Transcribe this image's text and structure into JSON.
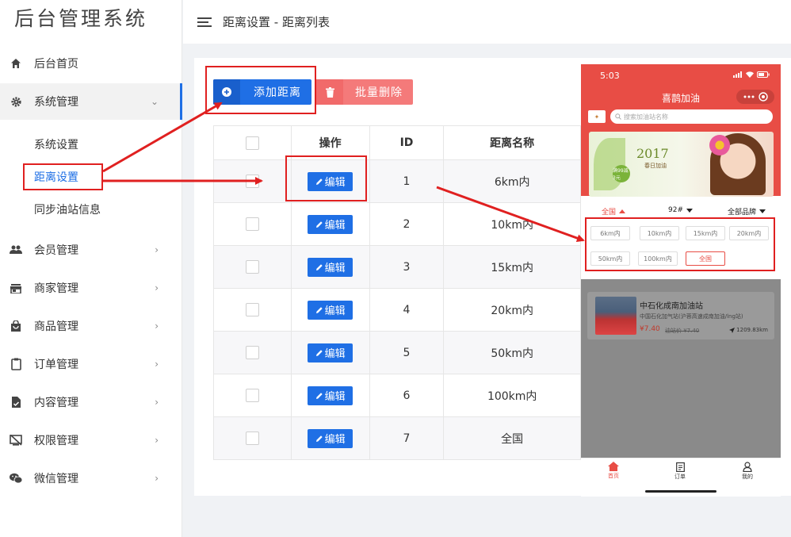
{
  "app": {
    "title": "后台管理系统"
  },
  "header": {
    "breadcrumb": "距离设置 - 距离列表"
  },
  "sidebar": {
    "items": [
      {
        "label": "后台首页",
        "icon": "home-icon"
      },
      {
        "label": "系统管理",
        "icon": "gear-icon",
        "expanded": true,
        "children": [
          {
            "label": "系统设置"
          },
          {
            "label": "距离设置",
            "active": true
          },
          {
            "label": "同步油站信息"
          }
        ]
      },
      {
        "label": "会员管理",
        "icon": "users-icon"
      },
      {
        "label": "商家管理",
        "icon": "store-icon"
      },
      {
        "label": "商品管理",
        "icon": "shopping-bag-icon"
      },
      {
        "label": "订单管理",
        "icon": "clipboard-icon"
      },
      {
        "label": "内容管理",
        "icon": "document-check-icon"
      },
      {
        "label": "权限管理",
        "icon": "screen-off-icon"
      },
      {
        "label": "微信管理",
        "icon": "wechat-icon"
      }
    ]
  },
  "toolbar": {
    "add_label": "添加距离",
    "delete_label": "批量删除"
  },
  "table": {
    "headers": {
      "action": "操作",
      "id": "ID",
      "name": "距离名称"
    },
    "edit_label": "编辑",
    "rows": [
      {
        "id": "1",
        "name": "6km内"
      },
      {
        "id": "2",
        "name": "10km内"
      },
      {
        "id": "3",
        "name": "15km内"
      },
      {
        "id": "4",
        "name": "20km内"
      },
      {
        "id": "5",
        "name": "50km内"
      },
      {
        "id": "6",
        "name": "100km内"
      },
      {
        "id": "7",
        "name": "全国"
      }
    ]
  },
  "phone": {
    "time": "5:03",
    "title": "喜鹊加油",
    "search_placeholder": "搜索加油站名称",
    "banner": {
      "year": "2017",
      "subtitle": "春日加油",
      "badge": "满99减3元"
    },
    "filters": {
      "region": "全国",
      "fuel": "92#",
      "brand": "全部品牌"
    },
    "chips": [
      "6km内",
      "10km内",
      "15km内",
      "20km内",
      "50km内",
      "100km内",
      "全国"
    ],
    "selected_chip": "全国",
    "station": {
      "name": "中石化成南加油站",
      "address": "中国石化加气站(沪蓉高速成南加油/lng站)",
      "price": "¥7.40",
      "old_price": "油站价 ¥7.40",
      "distance": "1209.83km"
    },
    "tabs": [
      {
        "label": "首页",
        "icon": "home-icon"
      },
      {
        "label": "订单",
        "icon": "order-icon"
      },
      {
        "label": "我的",
        "icon": "user-icon"
      }
    ]
  },
  "colors": {
    "primary": "#1f6fe5",
    "danger": "#f47a7a",
    "phone_red": "#e84d45",
    "annotation": "#e02020"
  }
}
